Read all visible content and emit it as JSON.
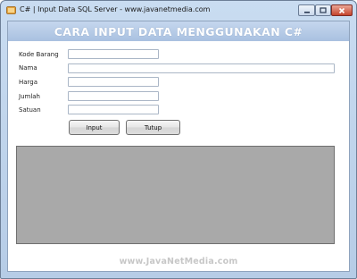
{
  "window": {
    "title": "C# | Input Data SQL Server - www.javanetmedia.com",
    "controls": {
      "minimize": "minimize",
      "maximize": "maximize",
      "close": "close"
    }
  },
  "header": {
    "title": "CARA INPUT DATA MENGGUNAKAN C#"
  },
  "form": {
    "kode_barang_label": "Kode Barang",
    "kode_barang_value": "",
    "nama_label": "Nama",
    "nama_value": "",
    "harga_label": "Harga",
    "harga_value": "",
    "jumlah_label": "Jumlah",
    "jumlah_value": "",
    "satuan_label": "Satuan",
    "satuan_value": ""
  },
  "buttons": {
    "input_label": "Input",
    "tutup_label": "Tutup"
  },
  "footer": {
    "text": "www.JavaNetMedia.com"
  },
  "colors": {
    "header_bg": "#b1c7e3",
    "grid_bg": "#a9a9a9",
    "footer_text": "#c7c7c7"
  }
}
